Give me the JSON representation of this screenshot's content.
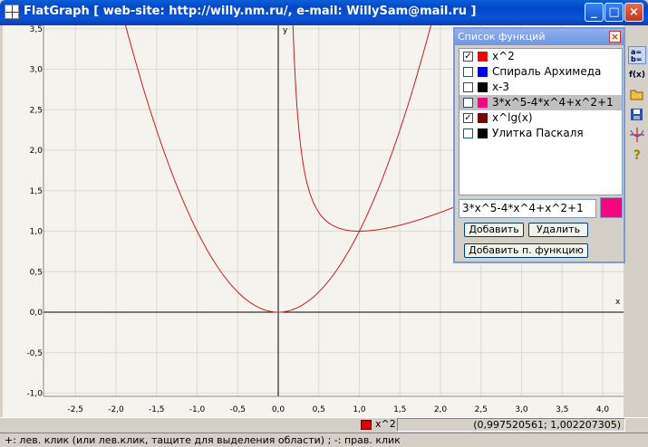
{
  "window": {
    "title": "FlatGraph  [ web-site: http://willy.nm.ru/, e-mail: WillySam@mail.ru ]"
  },
  "controls": {
    "minimize": "_",
    "maximize": "□",
    "close": "×"
  },
  "graph": {
    "x_range": [
      -2.85,
      4.2
    ],
    "y_range": [
      -1.1,
      3.55
    ],
    "x_ticks": [
      "-2,5",
      "-2,0",
      "-1,5",
      "-1,0",
      "-0,5",
      "0,0",
      "0,5",
      "1,0",
      "1,5",
      "2,0",
      "2,5",
      "3,0",
      "3,5",
      "4,0"
    ],
    "x_tick_values": [
      -2.5,
      -2,
      -1.5,
      -1,
      -0.5,
      0,
      0.5,
      1,
      1.5,
      2,
      2.5,
      3,
      3.5,
      4
    ],
    "y_ticks": [
      "-1,0",
      "-0,5",
      "0,0",
      "0,5",
      "1,0",
      "1,5",
      "2,0",
      "2,5",
      "3,0",
      "3,5"
    ],
    "y_tick_values": [
      -1,
      -0.5,
      0,
      0.5,
      1,
      1.5,
      2,
      2.5,
      3,
      3.5
    ],
    "x_axis_label": "x",
    "y_axis_label": "y",
    "curve_color": "#c81e1e"
  },
  "panel": {
    "title": "Список функций",
    "close": "×",
    "functions": [
      {
        "checked": true,
        "color": "#ff0000",
        "label": "x^2",
        "selected": false
      },
      {
        "checked": false,
        "color": "#0000ff",
        "label": "Спираль Архимеда",
        "selected": false
      },
      {
        "checked": false,
        "color": "#000000",
        "label": "x-3",
        "selected": false
      },
      {
        "checked": false,
        "color": "#ff0080",
        "label": "3*x^5-4*x^4+x^2+1",
        "selected": true
      },
      {
        "checked": true,
        "color": "#800000",
        "label": "x^lg(x)",
        "selected": false
      },
      {
        "checked": false,
        "color": "#000000",
        "label": "Улитка Паскаля",
        "selected": false
      }
    ],
    "expression": "3*x^5-4*x^4+x^2+1",
    "expression_color": "#ff0080",
    "add_label": "Добавить",
    "delete_label": "Удалить",
    "add_param_label": "Добавить п. функцию"
  },
  "toolbar": {
    "icons": [
      "ab-list-icon",
      "fx-icon",
      "open-folder-icon",
      "save-icon",
      "axes-icon",
      "help-icon"
    ],
    "fx_label": "f(x)",
    "help_label": "?"
  },
  "status": {
    "legend_label": "x^2",
    "legend_color": "#e00000",
    "coords": "(0,997520561; 1,002207305)"
  },
  "hint": "+: лев. клик (или лев.клик, тащите для выделения области) ; -: прав. клик"
}
